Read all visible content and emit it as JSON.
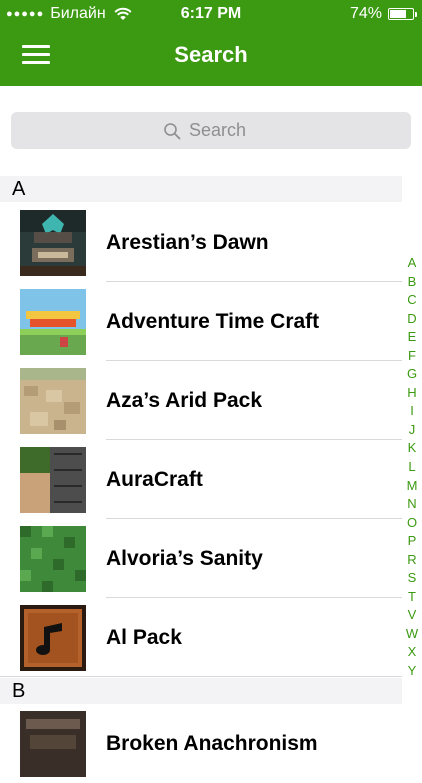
{
  "status_bar": {
    "carrier": "Билайн",
    "time": "6:17 PM",
    "battery": "74%",
    "battery_level": 0.74
  },
  "nav": {
    "title": "Search",
    "menu_icon": "hamburger-menu-icon"
  },
  "search": {
    "placeholder": "Search",
    "icon": "search-icon"
  },
  "sections": [
    {
      "letter": "A",
      "items": [
        {
          "name": "Arestian’s Dawn"
        },
        {
          "name": "Adventure Time Craft"
        },
        {
          "name": "Aza’s Arid Pack"
        },
        {
          "name": "AuraCraft"
        },
        {
          "name": "Alvoria’s Sanity"
        },
        {
          "name": "Al Pack"
        }
      ]
    },
    {
      "letter": "B",
      "items": [
        {
          "name": "Broken Anachronism"
        }
      ]
    }
  ],
  "index_letters": [
    "A",
    "B",
    "C",
    "D",
    "E",
    "F",
    "G",
    "H",
    "I",
    "J",
    "K",
    "L",
    "M",
    "N",
    "O",
    "P",
    "R",
    "S",
    "T",
    "V",
    "W",
    "X",
    "Y"
  ],
  "colors": {
    "accent": "#3c9a12",
    "section_bg": "#f3f3f5",
    "search_bg": "#e4e4e6"
  }
}
